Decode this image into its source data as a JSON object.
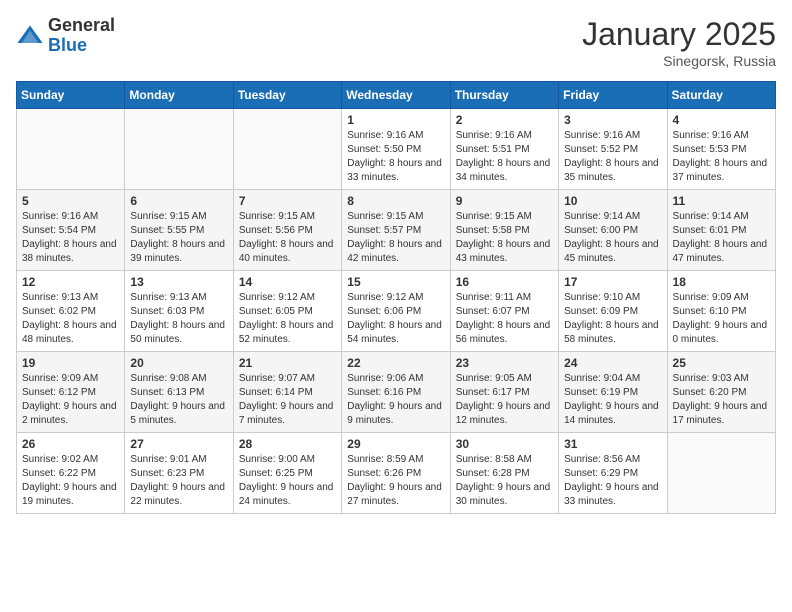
{
  "header": {
    "logo_general": "General",
    "logo_blue": "Blue",
    "month_title": "January 2025",
    "location": "Sinegorsk, Russia"
  },
  "weekdays": [
    "Sunday",
    "Monday",
    "Tuesday",
    "Wednesday",
    "Thursday",
    "Friday",
    "Saturday"
  ],
  "weeks": [
    [
      {
        "day": "",
        "info": ""
      },
      {
        "day": "",
        "info": ""
      },
      {
        "day": "",
        "info": ""
      },
      {
        "day": "1",
        "info": "Sunrise: 9:16 AM\nSunset: 5:50 PM\nDaylight: 8 hours and 33 minutes."
      },
      {
        "day": "2",
        "info": "Sunrise: 9:16 AM\nSunset: 5:51 PM\nDaylight: 8 hours and 34 minutes."
      },
      {
        "day": "3",
        "info": "Sunrise: 9:16 AM\nSunset: 5:52 PM\nDaylight: 8 hours and 35 minutes."
      },
      {
        "day": "4",
        "info": "Sunrise: 9:16 AM\nSunset: 5:53 PM\nDaylight: 8 hours and 37 minutes."
      }
    ],
    [
      {
        "day": "5",
        "info": "Sunrise: 9:16 AM\nSunset: 5:54 PM\nDaylight: 8 hours and 38 minutes."
      },
      {
        "day": "6",
        "info": "Sunrise: 9:15 AM\nSunset: 5:55 PM\nDaylight: 8 hours and 39 minutes."
      },
      {
        "day": "7",
        "info": "Sunrise: 9:15 AM\nSunset: 5:56 PM\nDaylight: 8 hours and 40 minutes."
      },
      {
        "day": "8",
        "info": "Sunrise: 9:15 AM\nSunset: 5:57 PM\nDaylight: 8 hours and 42 minutes."
      },
      {
        "day": "9",
        "info": "Sunrise: 9:15 AM\nSunset: 5:58 PM\nDaylight: 8 hours and 43 minutes."
      },
      {
        "day": "10",
        "info": "Sunrise: 9:14 AM\nSunset: 6:00 PM\nDaylight: 8 hours and 45 minutes."
      },
      {
        "day": "11",
        "info": "Sunrise: 9:14 AM\nSunset: 6:01 PM\nDaylight: 8 hours and 47 minutes."
      }
    ],
    [
      {
        "day": "12",
        "info": "Sunrise: 9:13 AM\nSunset: 6:02 PM\nDaylight: 8 hours and 48 minutes."
      },
      {
        "day": "13",
        "info": "Sunrise: 9:13 AM\nSunset: 6:03 PM\nDaylight: 8 hours and 50 minutes."
      },
      {
        "day": "14",
        "info": "Sunrise: 9:12 AM\nSunset: 6:05 PM\nDaylight: 8 hours and 52 minutes."
      },
      {
        "day": "15",
        "info": "Sunrise: 9:12 AM\nSunset: 6:06 PM\nDaylight: 8 hours and 54 minutes."
      },
      {
        "day": "16",
        "info": "Sunrise: 9:11 AM\nSunset: 6:07 PM\nDaylight: 8 hours and 56 minutes."
      },
      {
        "day": "17",
        "info": "Sunrise: 9:10 AM\nSunset: 6:09 PM\nDaylight: 8 hours and 58 minutes."
      },
      {
        "day": "18",
        "info": "Sunrise: 9:09 AM\nSunset: 6:10 PM\nDaylight: 9 hours and 0 minutes."
      }
    ],
    [
      {
        "day": "19",
        "info": "Sunrise: 9:09 AM\nSunset: 6:12 PM\nDaylight: 9 hours and 2 minutes."
      },
      {
        "day": "20",
        "info": "Sunrise: 9:08 AM\nSunset: 6:13 PM\nDaylight: 9 hours and 5 minutes."
      },
      {
        "day": "21",
        "info": "Sunrise: 9:07 AM\nSunset: 6:14 PM\nDaylight: 9 hours and 7 minutes."
      },
      {
        "day": "22",
        "info": "Sunrise: 9:06 AM\nSunset: 6:16 PM\nDaylight: 9 hours and 9 minutes."
      },
      {
        "day": "23",
        "info": "Sunrise: 9:05 AM\nSunset: 6:17 PM\nDaylight: 9 hours and 12 minutes."
      },
      {
        "day": "24",
        "info": "Sunrise: 9:04 AM\nSunset: 6:19 PM\nDaylight: 9 hours and 14 minutes."
      },
      {
        "day": "25",
        "info": "Sunrise: 9:03 AM\nSunset: 6:20 PM\nDaylight: 9 hours and 17 minutes."
      }
    ],
    [
      {
        "day": "26",
        "info": "Sunrise: 9:02 AM\nSunset: 6:22 PM\nDaylight: 9 hours and 19 minutes."
      },
      {
        "day": "27",
        "info": "Sunrise: 9:01 AM\nSunset: 6:23 PM\nDaylight: 9 hours and 22 minutes."
      },
      {
        "day": "28",
        "info": "Sunrise: 9:00 AM\nSunset: 6:25 PM\nDaylight: 9 hours and 24 minutes."
      },
      {
        "day": "29",
        "info": "Sunrise: 8:59 AM\nSunset: 6:26 PM\nDaylight: 9 hours and 27 minutes."
      },
      {
        "day": "30",
        "info": "Sunrise: 8:58 AM\nSunset: 6:28 PM\nDaylight: 9 hours and 30 minutes."
      },
      {
        "day": "31",
        "info": "Sunrise: 8:56 AM\nSunset: 6:29 PM\nDaylight: 9 hours and 33 minutes."
      },
      {
        "day": "",
        "info": ""
      }
    ]
  ]
}
